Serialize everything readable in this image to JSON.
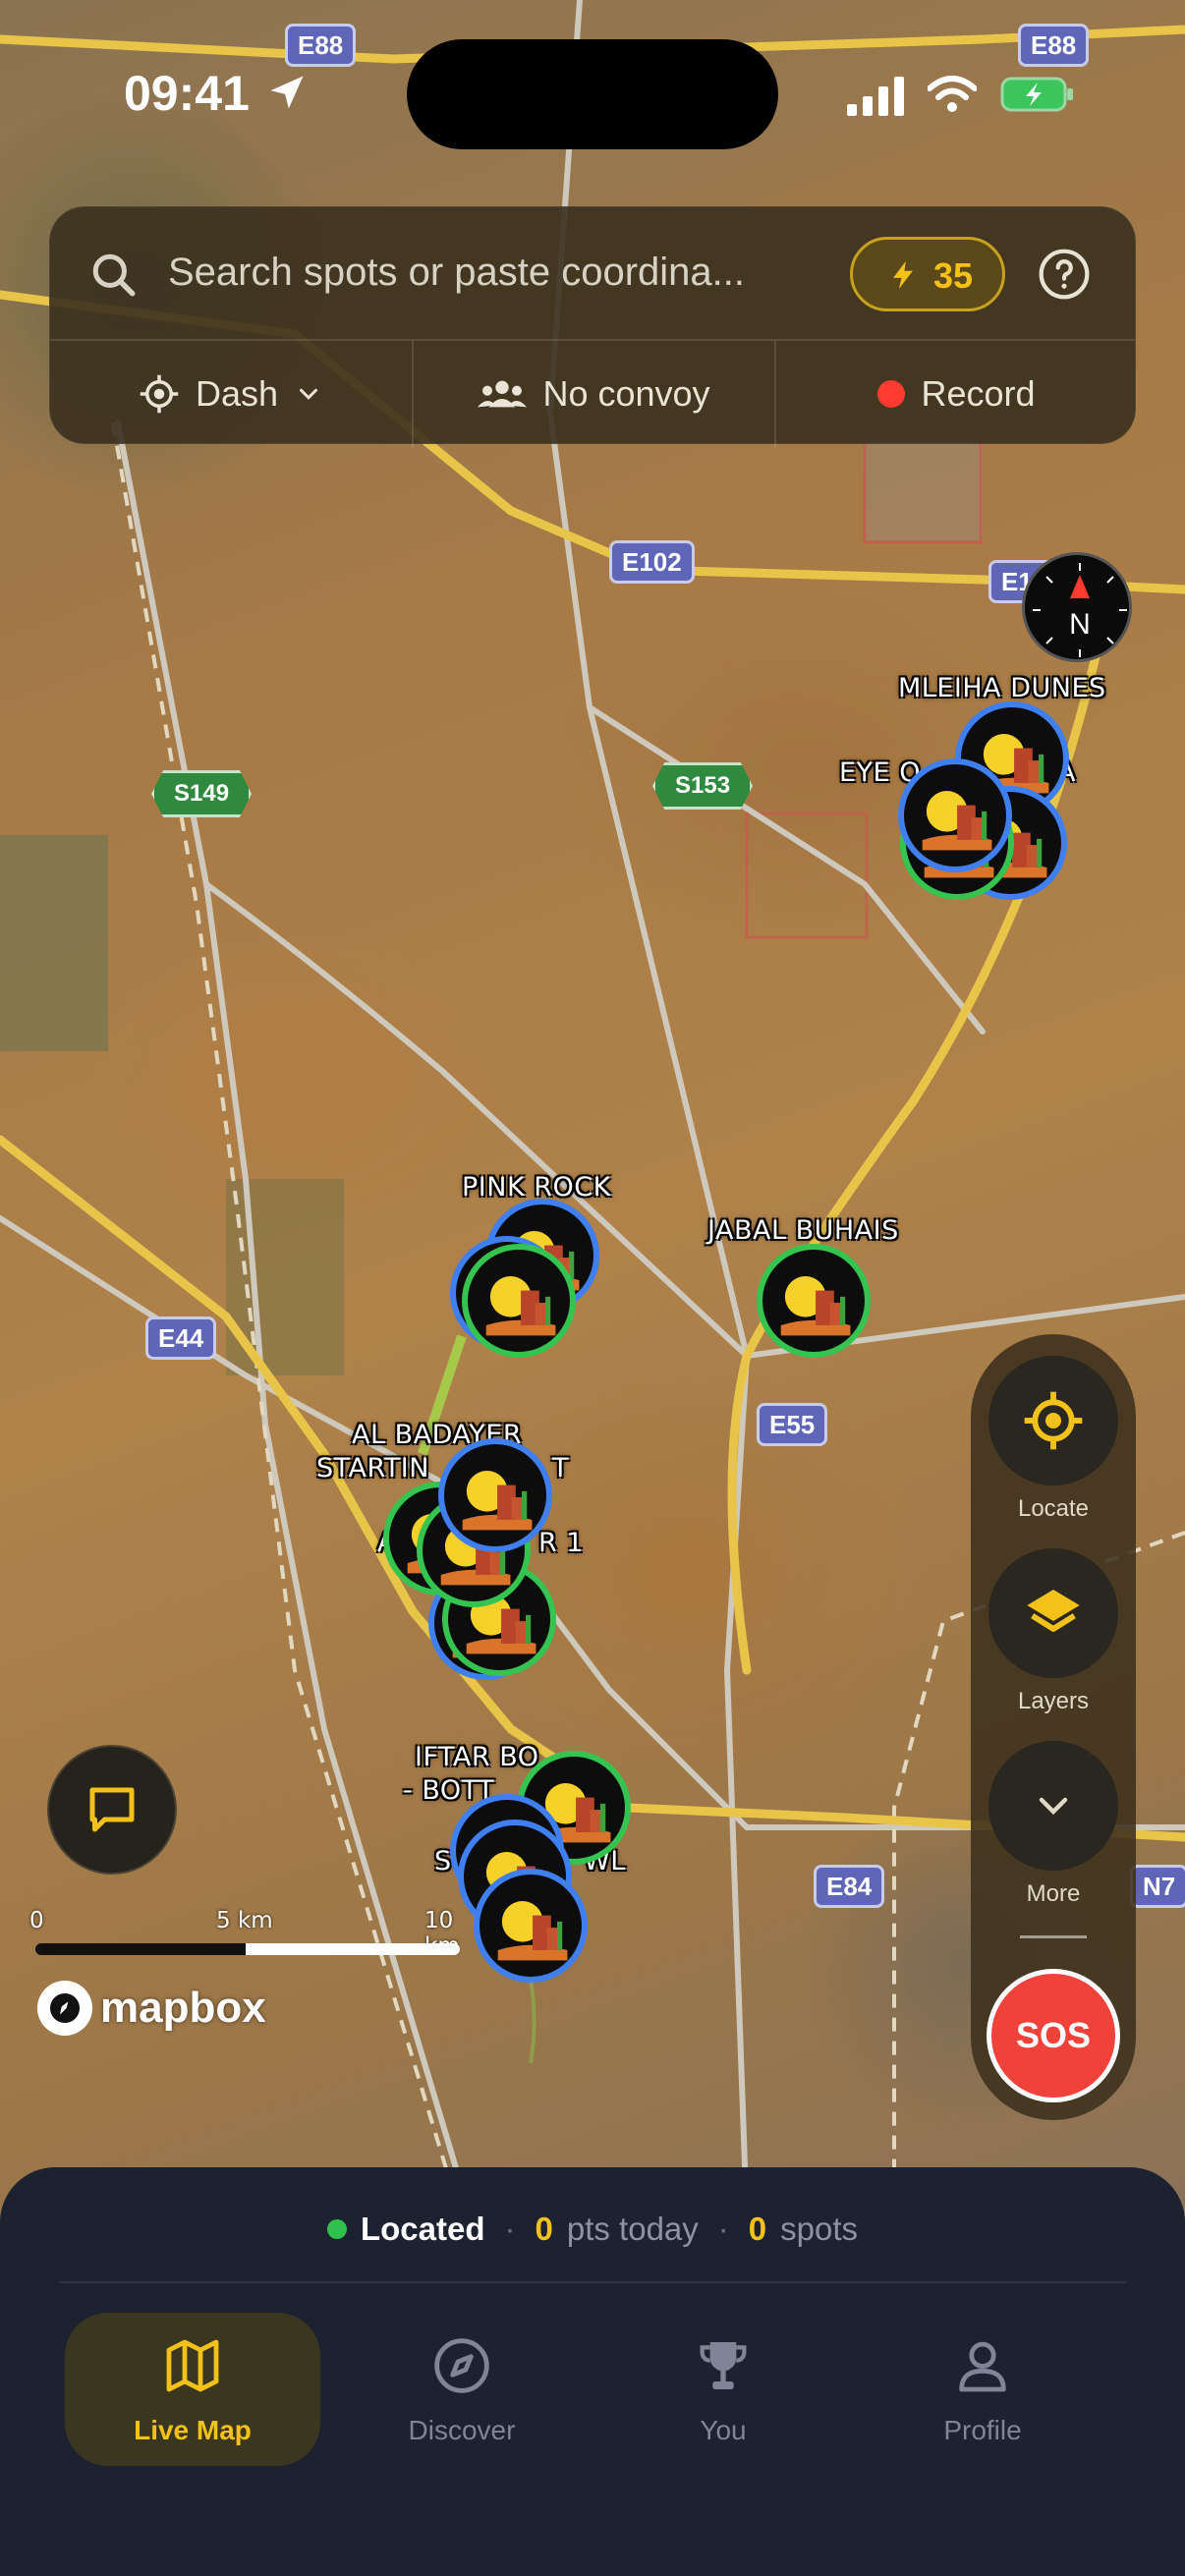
{
  "status_bar": {
    "time": "09:41"
  },
  "search": {
    "placeholder": "Search spots or paste coordina...",
    "points_badge": "35",
    "help_icon": "question-circle-icon"
  },
  "filters": {
    "vehicle": "Dash",
    "convoy": "No convoy",
    "record": "Record"
  },
  "map": {
    "road_shields": [
      "E88",
      "E88",
      "E102",
      "E102",
      "E44",
      "E55",
      "E84",
      "N7"
    ],
    "road_hexes": [
      "S149",
      "S153"
    ],
    "spot_labels": {
      "mleiha_dunes": "MLEIHA DUNES",
      "eye": "EYE O",
      "eye_tail": "A",
      "pink_rock": "PINK ROCK",
      "jabal_buhais": "JABAL BUHAIS",
      "al_badayer_1": "AL BADAYER",
      "al_badayer_2": "STARTIN",
      "al_badayer_2b": "T",
      "al_badayer_3": "A",
      "al_badayer_3b": "R 1",
      "iftar_1": "IFTAR BO",
      "iftar_1b": "",
      "iftar_2": "- BOTT",
      "iftar_3": "S",
      "iftar_3b": "WL"
    },
    "compass_label": "N",
    "scale": {
      "zero": "0",
      "mid": "5 km",
      "end": "10 km"
    },
    "attribution": "mapbox"
  },
  "tools": {
    "locate": "Locate",
    "layers": "Layers",
    "more": "More",
    "sos": "SOS"
  },
  "stats": {
    "located": "Located",
    "pts_value": "0",
    "pts_label": "pts today",
    "spots_value": "0",
    "spots_label": "spots"
  },
  "nav": [
    {
      "label": "Live Map",
      "icon": "map-icon",
      "active": true
    },
    {
      "label": "Discover",
      "icon": "compass-icon",
      "active": false
    },
    {
      "label": "You",
      "icon": "trophy-icon",
      "active": false
    },
    {
      "label": "Profile",
      "icon": "person-icon",
      "active": false
    }
  ],
  "colors": {
    "accent": "#f2c21a",
    "sos": "#f0413a",
    "pin_blue": "#3f7ff0",
    "pin_green": "#34c44f",
    "sheet": "#1c2230"
  }
}
